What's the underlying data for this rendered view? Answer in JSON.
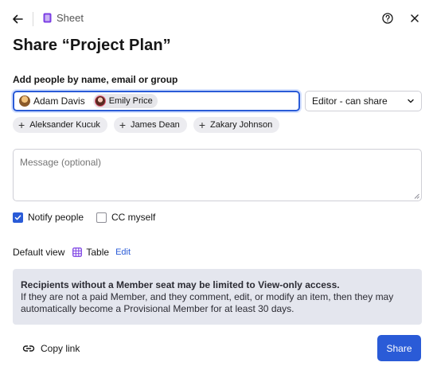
{
  "header": {
    "back_icon": "arrow-left-icon",
    "doc_type_icon": "sheet-icon",
    "doc_type_label": "Sheet",
    "help_icon": "help-circle-icon",
    "close_icon": "close-icon"
  },
  "title": "Share “Project Plan”",
  "people": {
    "label": "Add people by name, email or group",
    "selected": [
      {
        "name": "Adam Davis"
      },
      {
        "name": "Emily Price"
      }
    ],
    "role_select": {
      "value": "Editor - can share",
      "icon": "chevron-down-icon"
    }
  },
  "suggestions": [
    {
      "name": "Aleksander Kucuk"
    },
    {
      "name": "James Dean"
    },
    {
      "name": "Zakary Johnson"
    }
  ],
  "message": {
    "placeholder": "Message (optional)",
    "value": ""
  },
  "options": {
    "notify": {
      "label": "Notify people",
      "checked": true
    },
    "cc": {
      "label": "CC myself",
      "checked": false
    }
  },
  "default_view": {
    "label": "Default view",
    "value": "Table",
    "icon": "table-grid-icon",
    "edit_label": "Edit"
  },
  "notice": {
    "heading": "Recipients without a Member seat may be limited to View-only access.",
    "body": "If they are not a paid Member, and they comment, edit, or modify an item, then they may automatically become a Provisional Member for at least 30 days."
  },
  "footer": {
    "copy_link_label": "Copy link",
    "copy_link_icon": "link-icon",
    "share_label": "Share"
  },
  "colors": {
    "accent": "#2a5bd7",
    "notice_bg": "#e4e6ee",
    "chip_bg": "#ececf0",
    "sheet_icon": "#7b3fe4"
  }
}
